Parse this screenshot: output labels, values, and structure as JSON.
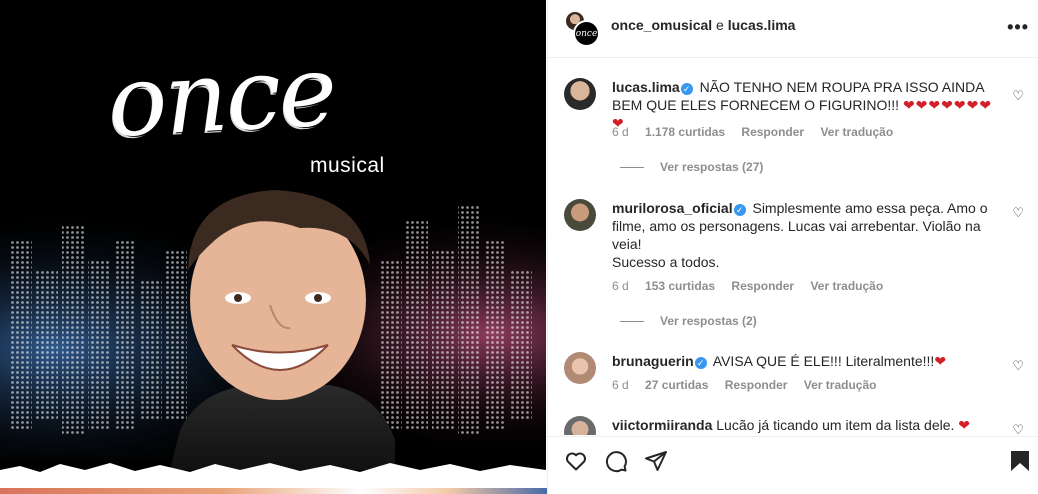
{
  "poster": {
    "logo_word": "once",
    "logo_sub": "musical"
  },
  "post_header": {
    "author1": "once_omusical",
    "connector": "e",
    "author2": "lucas.lima",
    "more_icon": "more-horizontal-icon"
  },
  "comments": [
    {
      "username": "lucas.lima",
      "verified": true,
      "text": "NÃO TENHO NEM ROUPA PRA ISSO AINDA BEM QUE ELES FORNECEM O FIGURINO!!!",
      "emoji": "❤❤❤❤❤❤❤❤",
      "time": "6 d",
      "likes": "1.178 curtidas",
      "reply": "Responder",
      "translate": "Ver tradução",
      "view_replies": "Ver respostas (27)"
    },
    {
      "username": "murilorosa_oficial",
      "verified": true,
      "text": "Simplesmente amo essa peça. Amo o filme, amo os personagens. Lucas vai arrebentar. Violão na veia!",
      "text2": "Sucesso a todos.",
      "time": "6 d",
      "likes": "153 curtidas",
      "reply": "Responder",
      "translate": "Ver tradução",
      "view_replies": "Ver respostas (2)"
    },
    {
      "username": "brunaguerin",
      "verified": true,
      "text": "AVISA QUE É ELE!!! Literalmente!!!",
      "emoji": "❤",
      "time": "6 d",
      "likes": "27 curtidas",
      "reply": "Responder",
      "translate": "Ver tradução"
    },
    {
      "username": "viictormiiranda",
      "verified": false,
      "text": "Lucão já ticando um item da lista dele.",
      "emoji": "❤"
    }
  ],
  "actions": {
    "like_icon": "heart-icon",
    "comment_icon": "comment-icon",
    "share_icon": "share-icon",
    "save_icon": "bookmark-icon"
  },
  "colors": {
    "verified": "#3897f0",
    "heart": "#d21f2a",
    "muted": "#8e8e8e",
    "text": "#262626"
  }
}
